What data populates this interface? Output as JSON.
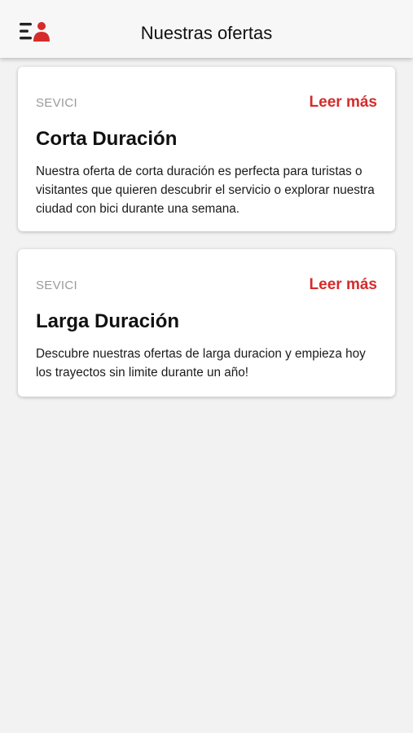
{
  "header": {
    "title": "Nuestras ofertas",
    "menu_icon": "menu-user-icon",
    "accent_color": "#d52b2b"
  },
  "offers": [
    {
      "tag": "SEVICI",
      "link_label": "Leer más",
      "title": "Corta Duración",
      "description": "Nuestra oferta de corta duración es perfecta para turistas o visitantes que quieren descubrir el servicio o explorar nuestra ciudad con bici durante una semana."
    },
    {
      "tag": "SEVICI",
      "link_label": "Leer más",
      "title": "Larga Duración",
      "description": "Descubre nuestras ofertas de larga duracion y empieza hoy los trayectos sin limite durante un año!"
    }
  ]
}
